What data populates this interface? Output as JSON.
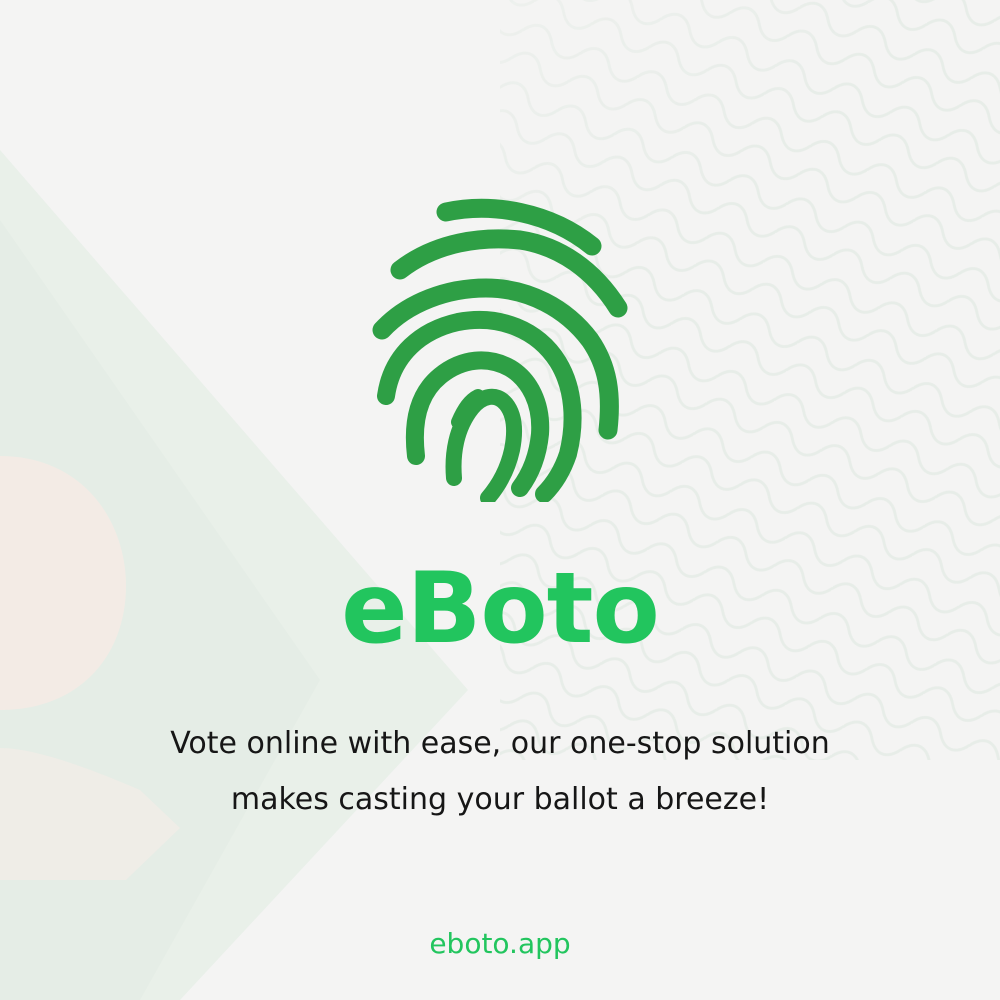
{
  "brand": {
    "name": "eBoto",
    "color": "#22c55e",
    "logo_color": "#2e9f45"
  },
  "tagline": {
    "line1": "Vote online with ease, our one-stop solution",
    "line2": "makes casting your ballot a breeze!"
  },
  "footer": {
    "website": "eboto.app"
  },
  "icons": {
    "logo": "fingerprint-icon"
  },
  "background": {
    "base_color": "#f3f3f2",
    "pattern_color": "#dfe7e0",
    "shape_green": "#e6efe7",
    "shape_peach": "#f3ece6"
  }
}
